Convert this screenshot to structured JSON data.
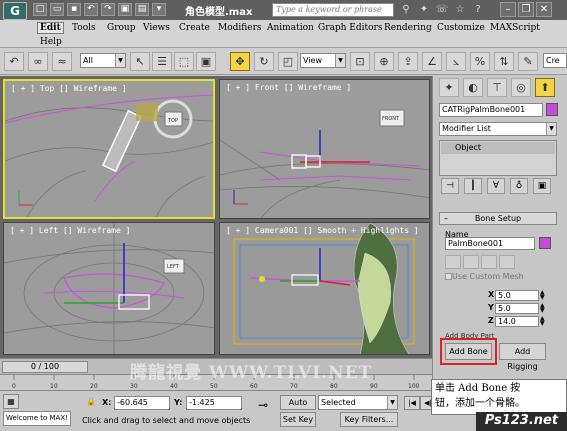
{
  "window": {
    "title": "角色模型.max",
    "search_placeholder": "Type a keyword or phrase",
    "logo_text": "G"
  },
  "menu": [
    "Edit",
    "Tools",
    "Group",
    "Views",
    "Create",
    "Modifiers",
    "Animation",
    "Graph Editors",
    "Rendering",
    "Customize",
    "MAXScript",
    "Help"
  ],
  "toolbar": {
    "selection_filter": "All",
    "reference_coord": "View",
    "named_selection": "Cre"
  },
  "viewports": {
    "top": "[ + ] Top [] Wireframe ]",
    "front": "[ + ] Front [] Wireframe ]",
    "left": "[ + ] Left [] Wireframe ]",
    "camera": "[ + ] Camera001 [] Smooth + Highlights ]",
    "cube_top": "TOP",
    "cube_front": "FRONT",
    "cube_left": "LEFT"
  },
  "timeline": {
    "frame": "0 / 100",
    "ticks": [
      "0",
      "10",
      "20",
      "30",
      "40",
      "50",
      "60",
      "70",
      "80",
      "90",
      "100"
    ]
  },
  "status": {
    "maxscript": "Welcome to MAX!",
    "prompt": "Click and drag to select and move objects",
    "x_label": "X:",
    "x_value": "-60.645",
    "y_label": "Y:",
    "y_value": "-1.425",
    "auto_key": "Auto Key",
    "set_key": "Set Key",
    "selected": "Selected",
    "key_filters": "Key Filters..."
  },
  "cmdpanel": {
    "object_name": "CATRigPalmBone001",
    "modifier_list": "Modifier List",
    "stack_item": "Object",
    "rollout": "Bone Setup",
    "name_label": "Name",
    "bone_name": "PalmBone001",
    "use_custom_mesh": "Use Custom Mesh",
    "dims": [
      {
        "label": "X",
        "value": "5.0"
      },
      {
        "label": "Y",
        "value": "5.0"
      },
      {
        "label": "Z",
        "value": "14.0"
      }
    ],
    "add_body_part": "Add Body Part",
    "add_bone": "Add Bone",
    "add_rigging": "Add Rigging"
  },
  "callout": {
    "line1": "单击 Add Bone 按",
    "line2": "钮，添加一个骨骼。"
  },
  "watermark": "腾龍視覺 WWW.TLVI.NET",
  "site_watermark": "Ps123.net",
  "colors": {
    "active_viewport": "#e6dc2c",
    "bone_magenta": "#c44bd6",
    "highlight_red": "#d22222"
  }
}
